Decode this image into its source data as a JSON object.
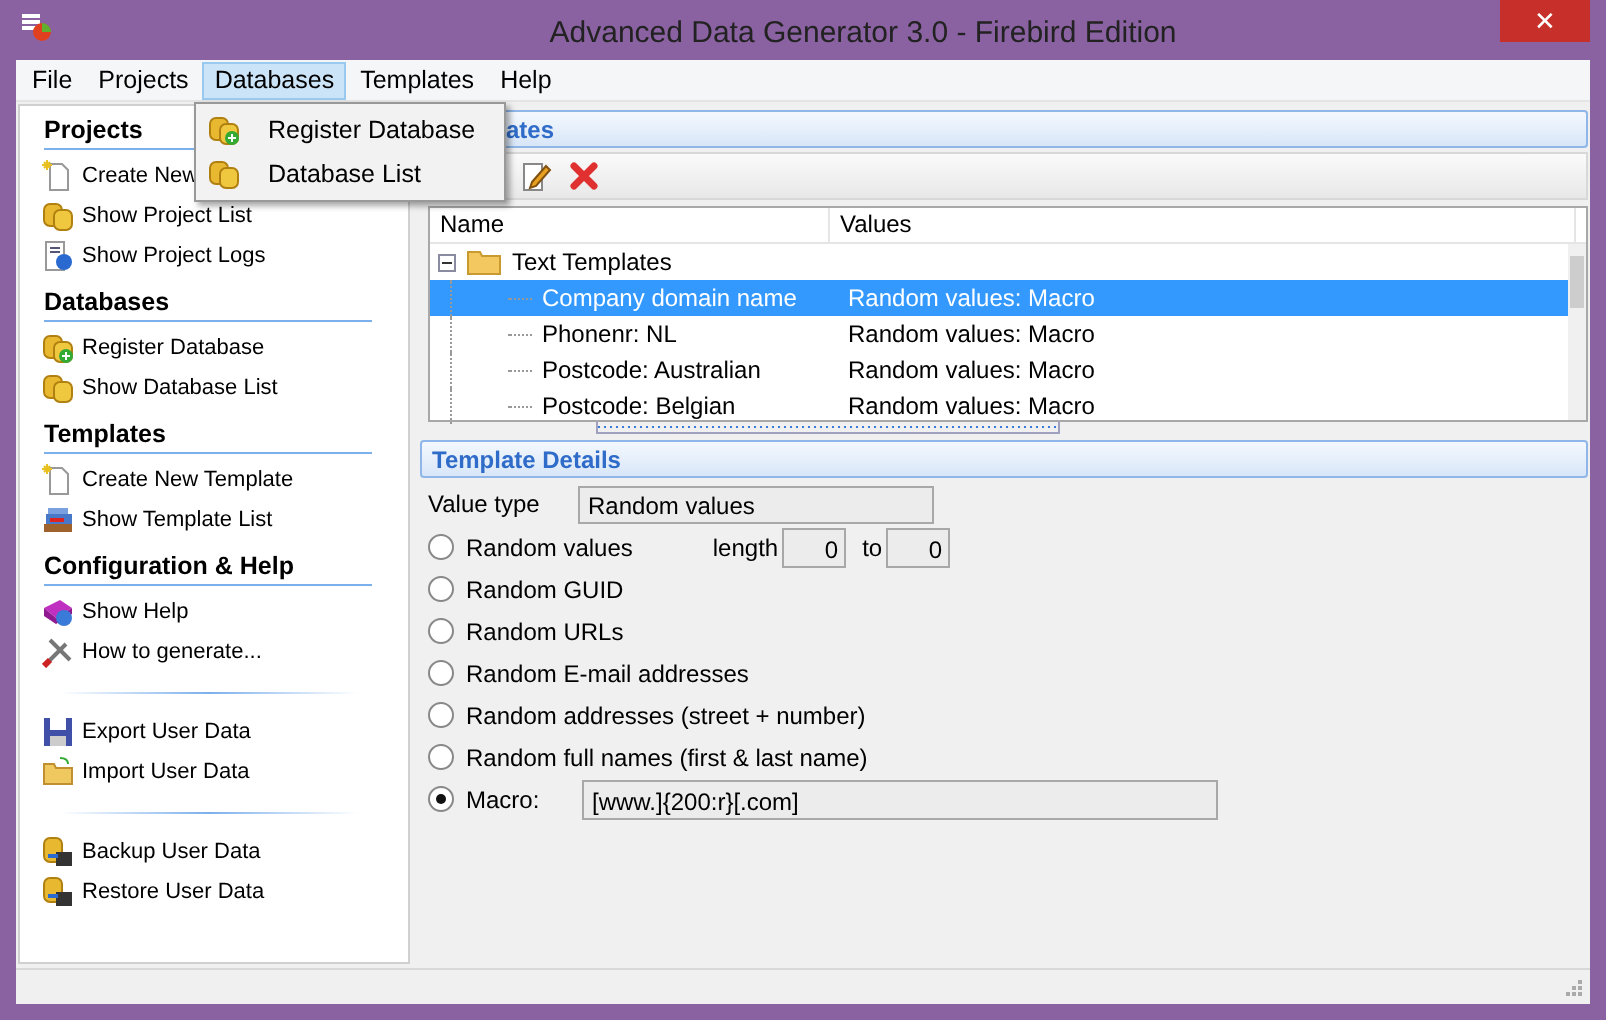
{
  "window": {
    "title": "Advanced Data Generator 3.0 - Firebird Edition",
    "close": "✕"
  },
  "menu": [
    {
      "label": "File",
      "selected": false
    },
    {
      "label": "Projects",
      "selected": false
    },
    {
      "label": "Databases",
      "selected": true
    },
    {
      "label": "Templates",
      "selected": false
    },
    {
      "label": "Help",
      "selected": false
    }
  ],
  "dropdown": [
    "Register Database",
    "Database List"
  ],
  "sidebar": [
    {
      "heading": "Projects",
      "items": [
        "Create New",
        "Show Project List",
        "Show Project Logs"
      ]
    },
    {
      "heading": "Databases",
      "items": [
        "Register Database",
        "Show Database List"
      ]
    },
    {
      "heading": "Templates",
      "items": [
        "Create  New Template",
        "Show Template List"
      ]
    },
    {
      "heading": "Configuration & Help",
      "items": [
        "Show Help",
        "How to generate..."
      ]
    },
    {
      "items": [
        "Export User Data",
        "Import User Data"
      ]
    },
    {
      "items": [
        "Backup User Data",
        "Restore User Data"
      ]
    }
  ],
  "templates_panel": {
    "title": "ates",
    "columns": [
      "Name",
      "Values"
    ],
    "tree": [
      {
        "name": "Text Templates",
        "expanded": true,
        "children": [
          {
            "name": "Company domain name",
            "value": "Random values: Macro",
            "selected": true
          },
          {
            "name": "Phonenr: NL",
            "value": "Random values: Macro",
            "selected": false
          },
          {
            "name": "Postcode: Australian",
            "value": "Random values: Macro",
            "selected": false
          },
          {
            "name": "Postcode: Belgian",
            "value": "Random values: Macro",
            "selected": false
          }
        ]
      }
    ]
  },
  "details": {
    "title": "Template Details",
    "value_type_label": "Value type",
    "value_type": "Random values",
    "options": [
      {
        "kind": "length",
        "label": "Random values",
        "selected": false,
        "length_label": "length",
        "from": "0",
        "to_label": "to",
        "to": "0"
      },
      {
        "kind": "plain",
        "label": "Random GUID",
        "selected": false
      },
      {
        "kind": "plain",
        "label": "Random URLs",
        "selected": false
      },
      {
        "kind": "plain",
        "label": "Random E-mail addresses",
        "selected": false
      },
      {
        "kind": "plain",
        "label": "Random addresses (street + number)",
        "selected": false
      },
      {
        "kind": "plain",
        "label": "Random full names (first & last name)",
        "selected": false
      },
      {
        "kind": "macro",
        "label": "Macro:",
        "selected": true,
        "value": "[www.]{200:r}[.com]"
      }
    ]
  }
}
